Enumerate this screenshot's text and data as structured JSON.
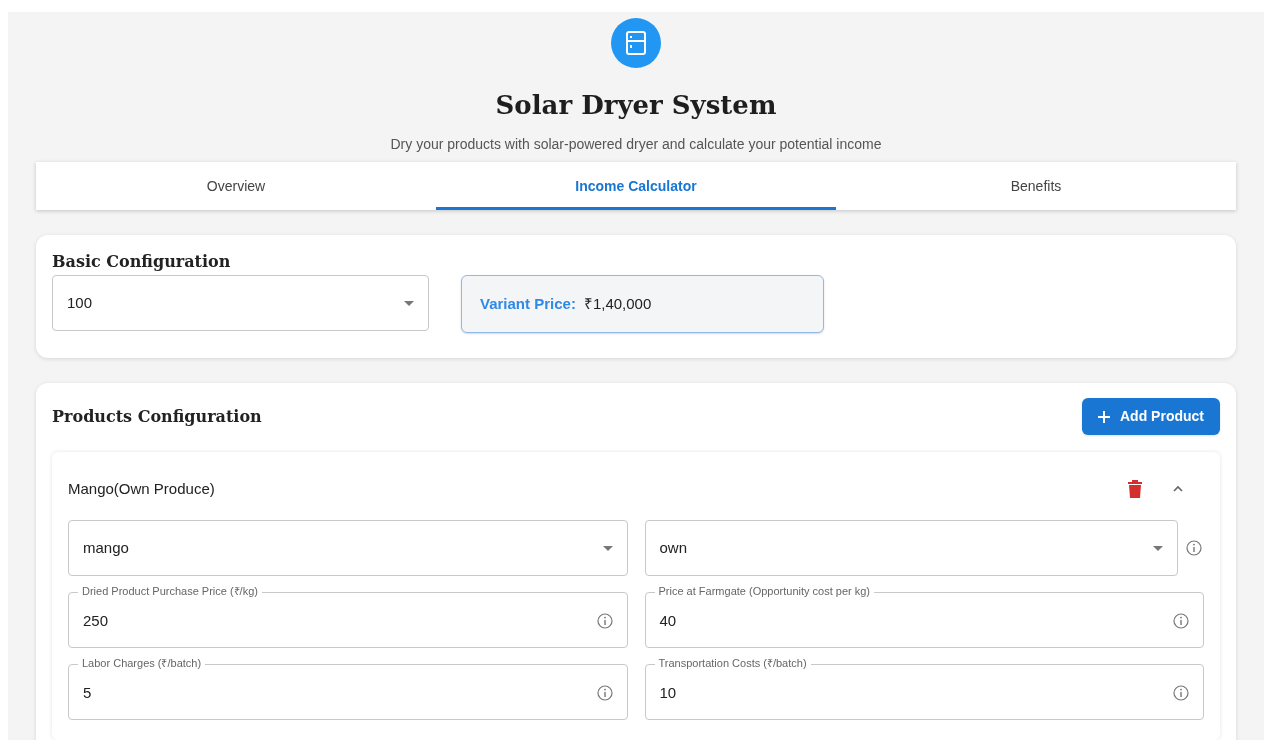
{
  "header": {
    "title": "Solar Dryer System",
    "subtitle": "Dry your products with solar-powered dryer and calculate your potential income"
  },
  "tabs": [
    {
      "label": "Overview",
      "selected": false
    },
    {
      "label": "Income Calculator",
      "selected": true
    },
    {
      "label": "Benefits",
      "selected": false
    }
  ],
  "basic_configuration": {
    "title": "Basic Configuration",
    "variant_select": {
      "value": "100"
    },
    "variant_price": {
      "label": "Variant Price:",
      "value": "₹1,40,000"
    }
  },
  "products_configuration": {
    "title": "Products Configuration",
    "add_button": "Add Product",
    "products": [
      {
        "name": "Mango(Own Produce)",
        "expanded": true,
        "fields": [
          {
            "kind": "select",
            "value": "mango",
            "info": false
          },
          {
            "kind": "select",
            "value": "own",
            "info": true
          },
          {
            "kind": "input",
            "label": "Dried Product Purchase Price (₹/kg)",
            "value": "250",
            "info": true
          },
          {
            "kind": "input",
            "label": "Price at Farmgate (Opportunity cost per kg)",
            "value": "40",
            "info": true
          },
          {
            "kind": "input",
            "label": "Labor Charges (₹/batch)",
            "value": "5",
            "info": true
          },
          {
            "kind": "input",
            "label": "Transportation Costs (₹/batch)",
            "value": "10",
            "info": true
          }
        ]
      }
    ]
  }
}
